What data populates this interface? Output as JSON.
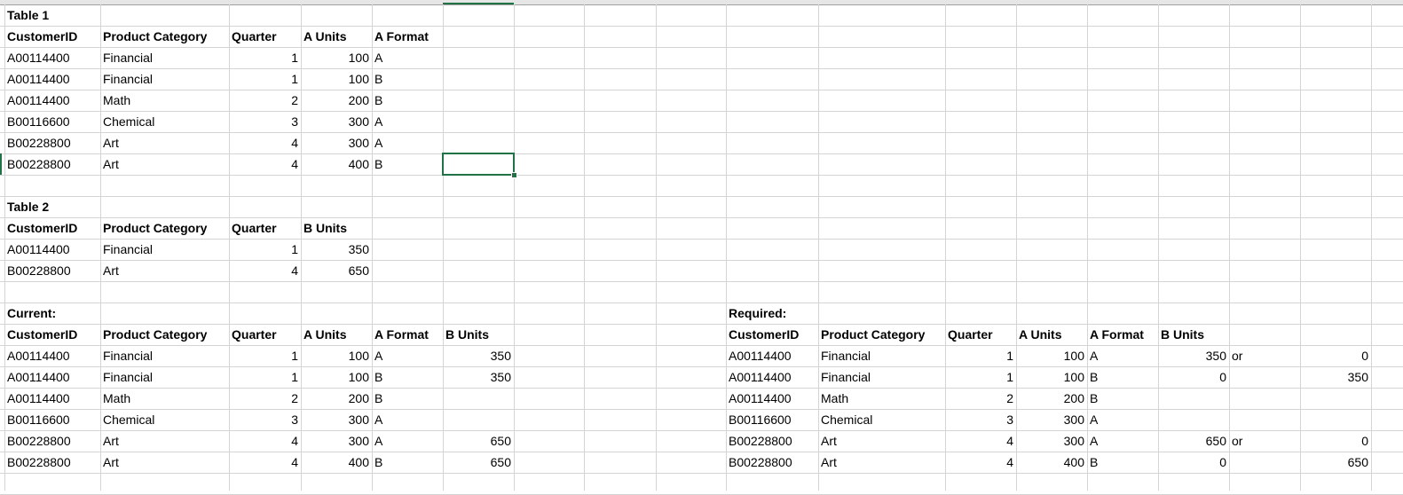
{
  "sheet": {
    "accent_color": "#217346",
    "grid_color": "#d4d4d4",
    "selected_cell": "F8"
  },
  "table1": {
    "title": "Table 1",
    "headers": [
      "CustomerID",
      "Product Category",
      "Quarter",
      "A Units",
      "A Format"
    ],
    "rows": [
      [
        "A00114400",
        "Financial",
        1,
        100,
        "A"
      ],
      [
        "A00114400",
        "Financial",
        1,
        100,
        "B"
      ],
      [
        "A00114400",
        "Math",
        2,
        200,
        "B"
      ],
      [
        "B00116600",
        "Chemical",
        3,
        300,
        "A"
      ],
      [
        "B00228800",
        "Art",
        4,
        300,
        "A"
      ],
      [
        "B00228800",
        "Art",
        4,
        400,
        "B"
      ]
    ]
  },
  "table2": {
    "title": "Table 2",
    "headers": [
      "CustomerID",
      "Product Category",
      "Quarter",
      "B Units"
    ],
    "rows": [
      [
        "A00114400",
        "Financial",
        1,
        350
      ],
      [
        "B00228800",
        "Art",
        4,
        650
      ]
    ]
  },
  "current": {
    "title": "Current:",
    "headers": [
      "CustomerID",
      "Product Category",
      "Quarter",
      "A Units",
      "A Format",
      "B Units"
    ],
    "rows": [
      [
        "A00114400",
        "Financial",
        1,
        100,
        "A",
        350
      ],
      [
        "A00114400",
        "Financial",
        1,
        100,
        "B",
        350
      ],
      [
        "A00114400",
        "Math",
        2,
        200,
        "B",
        ""
      ],
      [
        "B00116600",
        "Chemical",
        3,
        300,
        "A",
        ""
      ],
      [
        "B00228800",
        "Art",
        4,
        300,
        "A",
        650
      ],
      [
        "B00228800",
        "Art",
        4,
        400,
        "B",
        650
      ]
    ]
  },
  "required": {
    "title": "Required:",
    "headers": [
      "CustomerID",
      "Product Category",
      "Quarter",
      "A Units",
      "A Format",
      "B Units",
      "",
      ""
    ],
    "rows": [
      [
        "A00114400",
        "Financial",
        1,
        100,
        "A",
        350,
        "or",
        0
      ],
      [
        "A00114400",
        "Financial",
        1,
        100,
        "B",
        0,
        "",
        350
      ],
      [
        "A00114400",
        "Math",
        2,
        200,
        "B",
        "",
        "",
        ""
      ],
      [
        "B00116600",
        "Chemical",
        3,
        300,
        "A",
        "",
        "",
        ""
      ],
      [
        "B00228800",
        "Art",
        4,
        300,
        "A",
        650,
        "or",
        0
      ],
      [
        "B00228800",
        "Art",
        4,
        400,
        "B",
        0,
        "",
        650
      ]
    ]
  }
}
